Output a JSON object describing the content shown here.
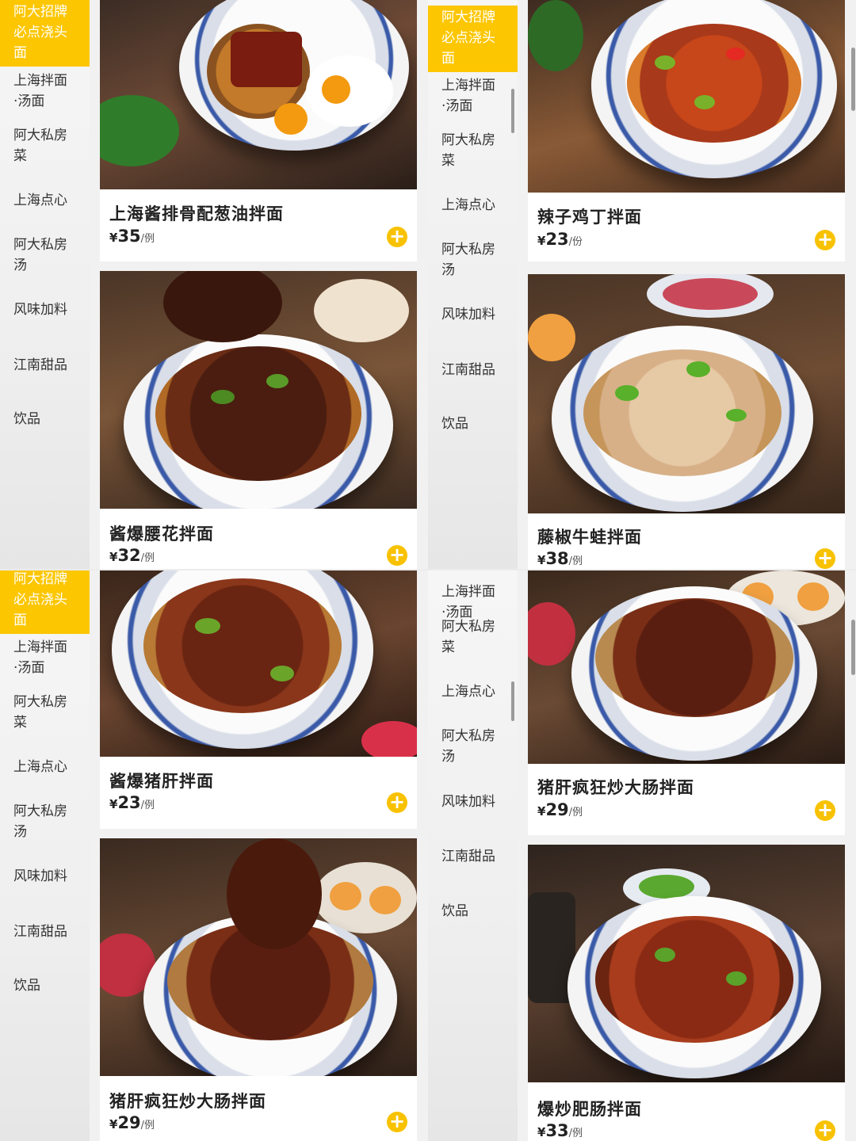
{
  "categories": [
    "阿大招牌\n必点浇头\n面",
    "上海拌面\n·汤面",
    "阿大私房\n菜",
    "上海点心",
    "阿大私房\n汤",
    "风味加料",
    "江南甜品",
    "饮品"
  ],
  "top_left": {
    "items": [
      {
        "name": "上海酱排骨配葱油拌面",
        "currency": "¥",
        "price": "35",
        "unit": "/例"
      },
      {
        "name": "酱爆腰花拌面",
        "currency": "¥",
        "price": "32",
        "unit": "/例"
      }
    ]
  },
  "top_right": {
    "items": [
      {
        "name": "辣子鸡丁拌面",
        "currency": "¥",
        "price": "23",
        "unit": "/份"
      },
      {
        "name": "藤椒牛蛙拌面",
        "currency": "¥",
        "price": "38",
        "unit": "/例"
      }
    ]
  },
  "bottom_left": {
    "items": [
      {
        "name": "酱爆猪肝拌面",
        "currency": "¥",
        "price": "23",
        "unit": "/例"
      },
      {
        "name": "猪肝疯狂炒大肠拌面",
        "currency": "¥",
        "price": "29",
        "unit": "/例"
      }
    ]
  },
  "bottom_right": {
    "partial_category_top": "上海拌面",
    "partial_category_rest": "·汤面",
    "items": [
      {
        "name": "猪肝疯狂炒大肠拌面",
        "currency": "¥",
        "price": "29",
        "unit": "/例"
      },
      {
        "name": "爆炒肥肠拌面",
        "currency": "¥",
        "price": "33",
        "unit": "/例"
      }
    ]
  },
  "icons": {
    "add": "plus-circle-icon"
  },
  "colors": {
    "accent": "#fcc600",
    "add_button": "#f8c200"
  }
}
